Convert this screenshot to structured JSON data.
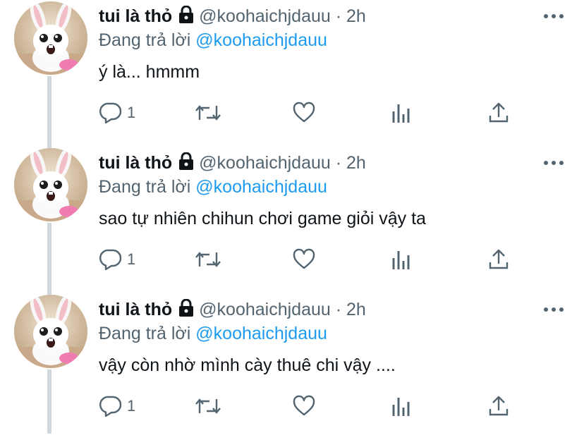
{
  "tweets": [
    {
      "author_name": "tui là thỏ",
      "handle": "@koohaichjdauu",
      "separator": "·",
      "time": "2h",
      "replying_prefix": "Đang trả lời",
      "replying_to": "@koohaichjdauu",
      "text": "ý là... hmmm",
      "reply_count": "1"
    },
    {
      "author_name": "tui là thỏ",
      "handle": "@koohaichjdauu",
      "separator": "·",
      "time": "2h",
      "replying_prefix": "Đang trả lời",
      "replying_to": "@koohaichjdauu",
      "text": "sao tự nhiên chihun chơi game giỏi vậy ta",
      "reply_count": "1"
    },
    {
      "author_name": "tui là thỏ",
      "handle": "@koohaichjdauu",
      "separator": "·",
      "time": "2h",
      "replying_prefix": "Đang trả lời",
      "replying_to": "@koohaichjdauu",
      "text": "vậy còn nhờ mình cày thuê chi vậy ....",
      "reply_count": "1"
    }
  ],
  "icons": {
    "lock": "lock-icon",
    "more": "more-icon",
    "reply": "reply-icon",
    "retweet": "retweet-icon",
    "like": "heart-icon",
    "analytics": "analytics-icon",
    "share": "share-icon"
  },
  "colors": {
    "link": "#1d9bf0",
    "secondary_text": "#536471",
    "thread_line": "#cfd9de"
  }
}
